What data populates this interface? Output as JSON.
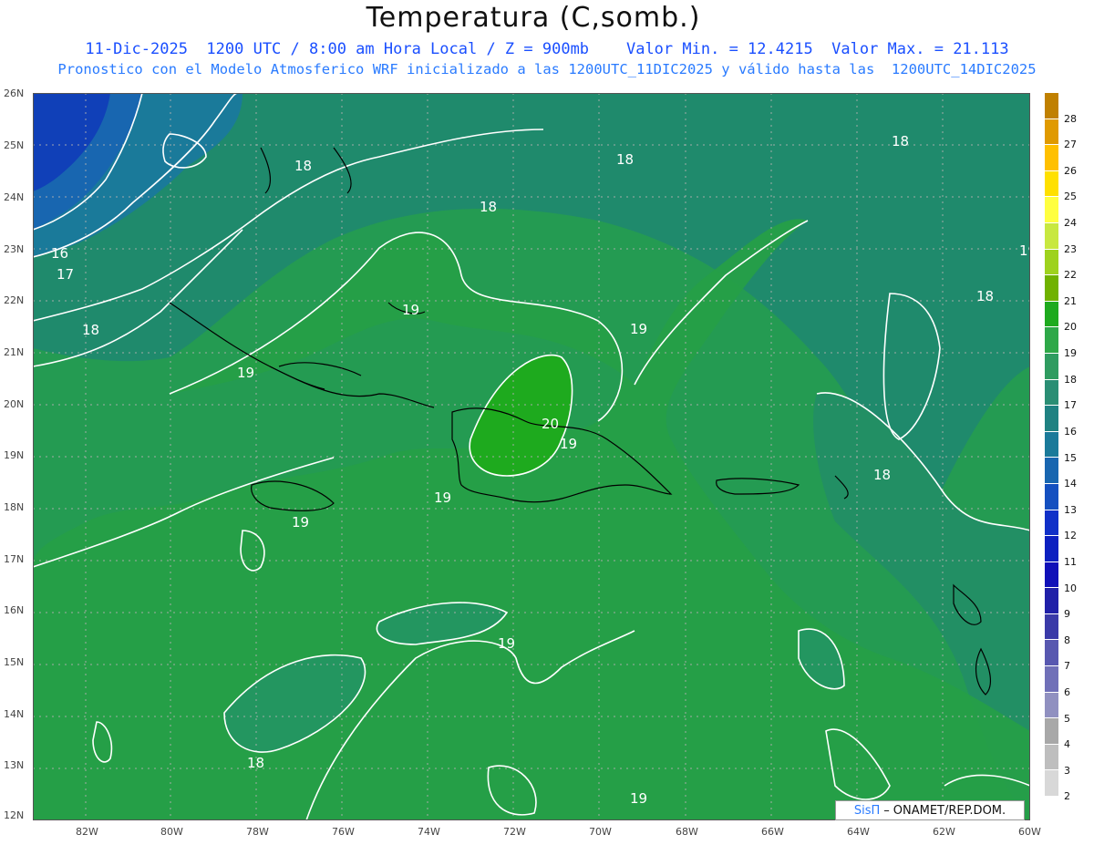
{
  "title": "Temperatura (C,somb.)",
  "subtitle_line1": "11-Dic-2025  1200 UTC / 8:00 am Hora Local / Z = 900mb    Valor Min. = 12.4215  Valor Max. = 21.113",
  "subtitle_line2": "Pronostico con el Modelo Atmosferico WRF inicializado a las 1200UTC_11DIC2025 y válido hasta las  1200UTC_14DIC2025",
  "lat_labels": [
    "26N",
    "25N",
    "24N",
    "23N",
    "22N",
    "21N",
    "20N",
    "19N",
    "18N",
    "17N",
    "16N",
    "15N",
    "14N",
    "13N",
    "12N"
  ],
  "lon_labels": [
    "82W",
    "80W",
    "78W",
    "76W",
    "74W",
    "72W",
    "70W",
    "68W",
    "66W",
    "64W",
    "62W",
    "60W"
  ],
  "colorbar": {
    "labels": [
      "28",
      "27",
      "26",
      "25",
      "24",
      "23",
      "22",
      "21",
      "20",
      "19",
      "18",
      "17",
      "16",
      "15",
      "14",
      "13",
      "12",
      "11",
      "10",
      "9",
      "8",
      "7",
      "6",
      "5",
      "4",
      "3",
      "2"
    ],
    "colors": [
      "#c08000",
      "#e09a00",
      "#ffc000",
      "#ffe000",
      "#ffff40",
      "#c8e840",
      "#9ed21e",
      "#70b200",
      "#1eaa1e",
      "#2ea848",
      "#2f9c60",
      "#2a8e74",
      "#1f8282",
      "#1a7a9a",
      "#1866b0",
      "#1450c0",
      "#1030c8",
      "#0c20c0",
      "#1010b8",
      "#2020a8",
      "#3a3aa8",
      "#5858b0",
      "#7070b8",
      "#9090c0",
      "#a8a8a8",
      "#bebebe",
      "#d8d8d8",
      "#ffffff"
    ]
  },
  "contour_labels": [
    "16",
    "17",
    "18",
    "18",
    "18",
    "18",
    "18",
    "18",
    "18",
    "18",
    "19",
    "19",
    "19",
    "19",
    "19",
    "19",
    "19",
    "19",
    "19",
    "20"
  ],
  "credit": {
    "brand": "SisΠ",
    "text": "ONAMET/REP.DOM."
  }
}
